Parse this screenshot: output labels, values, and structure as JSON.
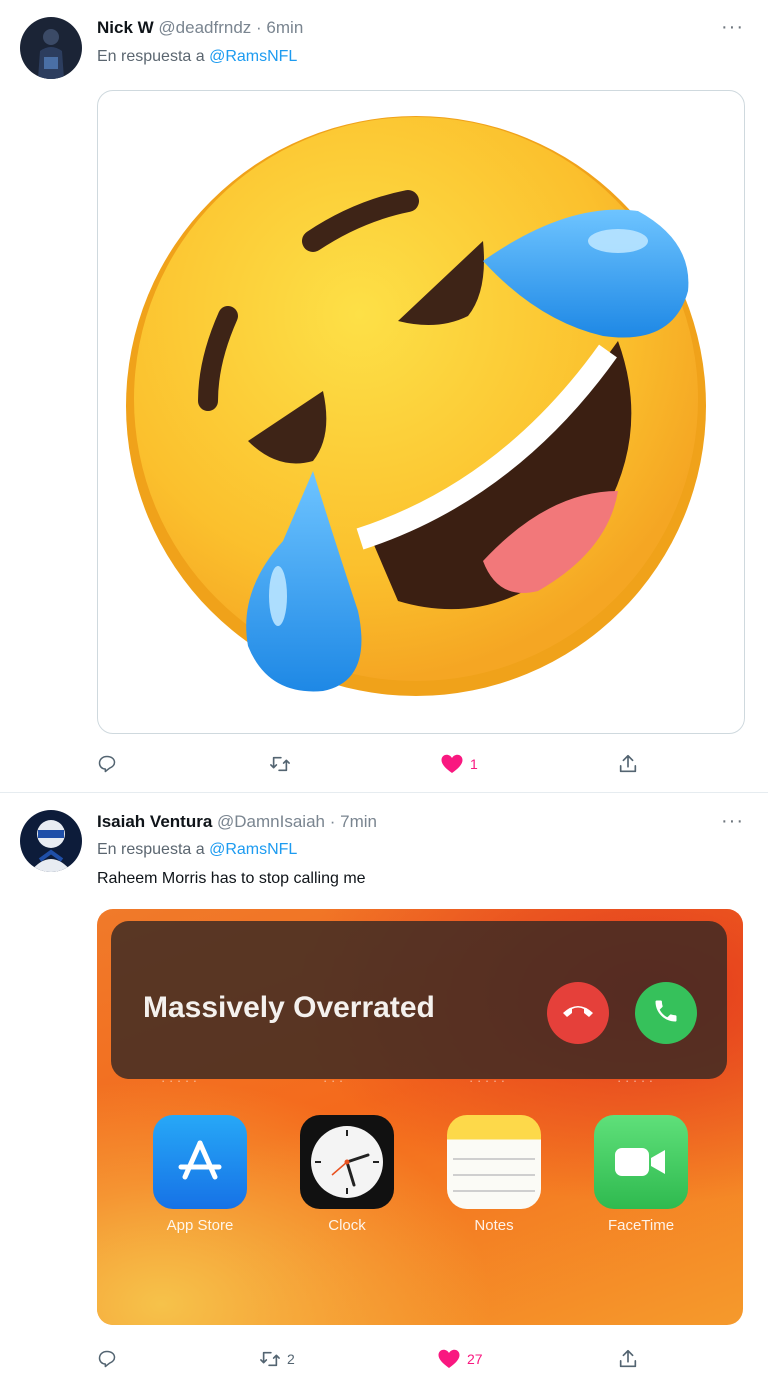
{
  "tweets": [
    {
      "name": "Nick W",
      "handle": "@deadfrndz",
      "time": "6min",
      "reply_prefix": "En respuesta a",
      "reply_mention": "@RamsNFL",
      "text": "",
      "media": "rolling-on-floor-laughing emoji",
      "more": "···",
      "retweets": "",
      "likes": "1",
      "liked": true
    },
    {
      "name": "Isaiah Ventura",
      "handle": "@DamnIsaiah",
      "time": "7min",
      "reply_prefix": "En respuesta a",
      "reply_mention": "@RamsNFL",
      "text": "Raheem Morris has to stop calling me",
      "more": "···",
      "retweets": "2",
      "likes": "27",
      "liked": true,
      "phone": {
        "caller": "Massively Overrated",
        "apps": [
          "App Store",
          "Clock",
          "Notes",
          "FaceTime"
        ]
      }
    }
  ],
  "colors": {
    "like": "#f91880",
    "mention": "#1d9bf0"
  },
  "icons": [
    "reply-icon",
    "retweet-icon",
    "heart-icon",
    "share-icon",
    "more-icon"
  ]
}
